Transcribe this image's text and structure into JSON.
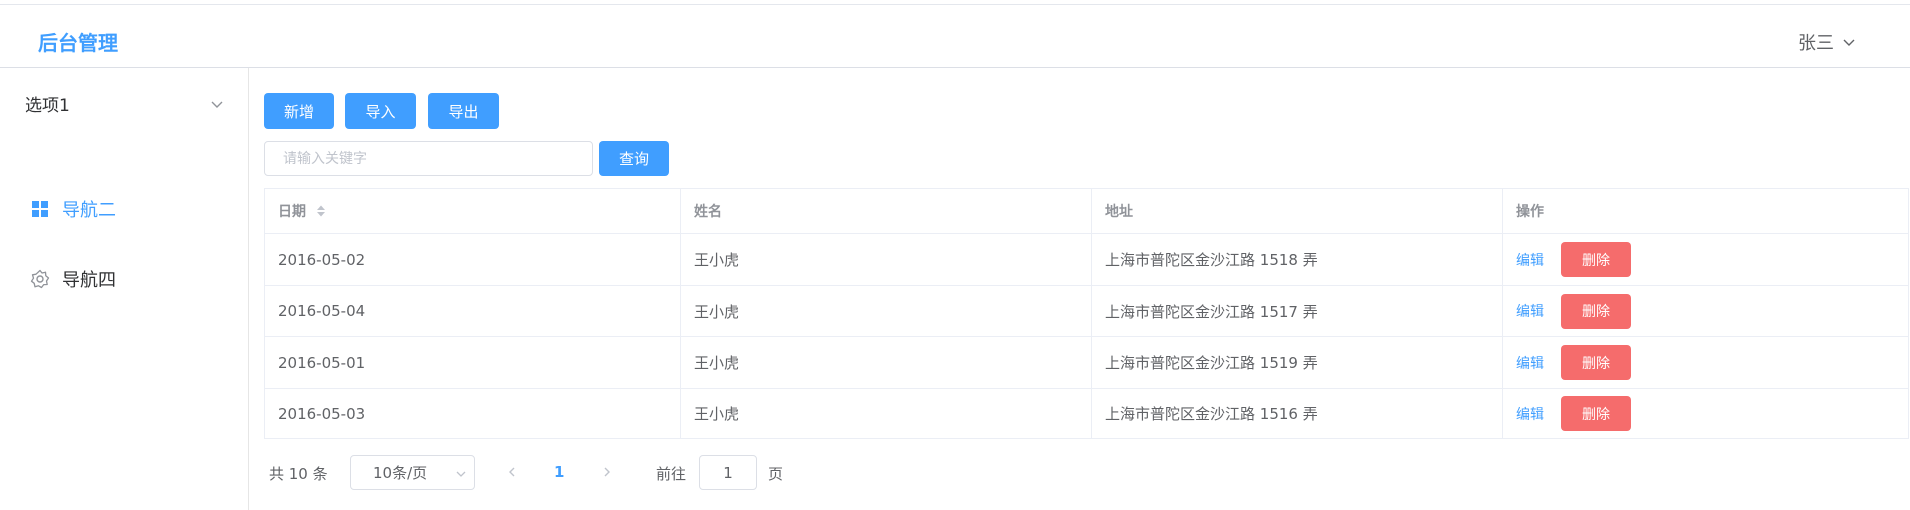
{
  "app": {
    "title": "后台管理"
  },
  "header": {
    "user": "张三"
  },
  "sidebar": {
    "submenu": {
      "label": "选项1"
    },
    "items": [
      {
        "label": "导航二",
        "icon": "grid-icon",
        "active": true
      },
      {
        "label": "导航四",
        "icon": "gear-icon",
        "active": false
      }
    ]
  },
  "toolbar": {
    "add_label": "新增",
    "import_label": "导入",
    "export_label": "导出",
    "search_placeholder": "请输入关键字",
    "search_value": "",
    "query_label": "查询"
  },
  "table": {
    "columns": [
      "日期",
      "姓名",
      "地址",
      "操作"
    ],
    "rows": [
      {
        "date": "2016-05-02",
        "name": "王小虎",
        "address": "上海市普陀区金沙江路 1518 弄"
      },
      {
        "date": "2016-05-04",
        "name": "王小虎",
        "address": "上海市普陀区金沙江路 1517 弄"
      },
      {
        "date": "2016-05-01",
        "name": "王小虎",
        "address": "上海市普陀区金沙江路 1519 弄"
      },
      {
        "date": "2016-05-03",
        "name": "王小虎",
        "address": "上海市普陀区金沙江路 1516 弄"
      }
    ],
    "edit_label": "编辑",
    "delete_label": "删除"
  },
  "pagination": {
    "total_text": "共 10 条",
    "page_size": "10条/页",
    "current_page": "1",
    "goto_label": "前往",
    "goto_value": "1",
    "page_unit": "页"
  },
  "colors": {
    "primary": "#409eff",
    "danger": "#f56c6c"
  }
}
